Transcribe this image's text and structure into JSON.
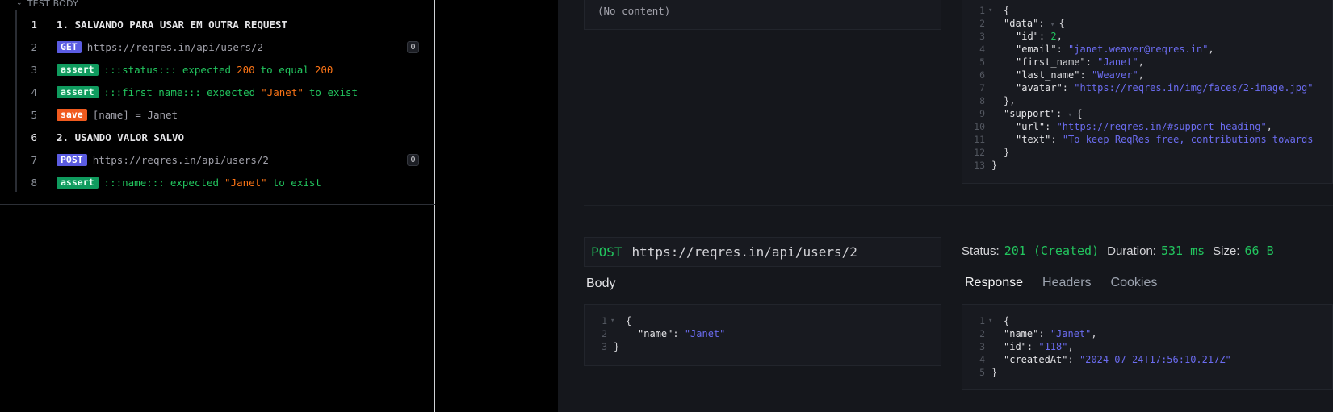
{
  "test_body": {
    "header": "TEST BODY",
    "lines": [
      {
        "num": "1",
        "kind": "section",
        "text": "1. SALVANDO PARA USAR EM OUTRA REQUEST"
      },
      {
        "num": "2",
        "kind": "request",
        "method": "GET",
        "url": "https://reqres.in/api/users/2",
        "count": "0"
      },
      {
        "num": "3",
        "kind": "assert",
        "badge": "assert",
        "subject": ":::status:::",
        "verb": "expected",
        "value": "200",
        "rest": "to equal",
        "value2": "200"
      },
      {
        "num": "4",
        "kind": "assert",
        "badge": "assert",
        "subject": ":::first_name:::",
        "verb": "expected",
        "value": "\"Janet\"",
        "rest": "to exist"
      },
      {
        "num": "5",
        "kind": "save",
        "badge": "save",
        "text": "[name] = Janet"
      },
      {
        "num": "6",
        "kind": "section",
        "text": "2. USANDO VALOR SALVO"
      },
      {
        "num": "7",
        "kind": "request",
        "method": "POST",
        "url": "https://reqres.in/api/users/2",
        "count": "0"
      },
      {
        "num": "8",
        "kind": "assert",
        "badge": "assert",
        "subject": ":::name:::",
        "verb": "expected",
        "value": "\"Janet\"",
        "rest": "to exist"
      }
    ]
  },
  "first_request": {
    "body_text": "(No content)",
    "response_lines": [
      {
        "n": "1",
        "text": "{"
      },
      {
        "n": "2",
        "key": "\"data\"",
        "text": "{"
      },
      {
        "n": "3",
        "key": "\"id\"",
        "num": "2"
      },
      {
        "n": "4",
        "key": "\"email\"",
        "str": "\"janet.weaver@reqres.in\""
      },
      {
        "n": "5",
        "key": "\"first_name\"",
        "str": "\"Janet\""
      },
      {
        "n": "6",
        "key": "\"last_name\"",
        "str": "\"Weaver\""
      },
      {
        "n": "7",
        "key": "\"avatar\"",
        "str": "\"https://reqres.in/img/faces/2-image.jpg\""
      },
      {
        "n": "8",
        "text": "},"
      },
      {
        "n": "9",
        "key": "\"support\"",
        "text": "{"
      },
      {
        "n": "10",
        "key": "\"url\"",
        "str": "\"https://reqres.in/#support-heading\""
      },
      {
        "n": "11",
        "key": "\"text\"",
        "str": "\"To keep ReqRes free, contributions towards"
      },
      {
        "n": "12",
        "text": "}"
      },
      {
        "n": "13",
        "text": "}"
      }
    ]
  },
  "second_request": {
    "method": "POST",
    "url": "https://reqres.in/api/users/2",
    "status_label": "Status:",
    "status_value": "201 (Created)",
    "duration_label": "Duration:",
    "duration_value": "531 ms",
    "size_label": "Size:",
    "size_value": "66 B",
    "body_label": "Body",
    "tabs": [
      "Response",
      "Headers",
      "Cookies"
    ],
    "body_lines": [
      {
        "n": "1",
        "text": "{"
      },
      {
        "n": "2",
        "key": "\"name\"",
        "str": "\"Janet\""
      },
      {
        "n": "3",
        "text": "}"
      }
    ],
    "response_lines": [
      {
        "n": "1",
        "text": "{"
      },
      {
        "n": "2",
        "key": "\"name\"",
        "str": "\"Janet\"",
        "comma": true
      },
      {
        "n": "3",
        "key": "\"id\"",
        "str": "\"118\"",
        "comma": true
      },
      {
        "n": "4",
        "key": "\"createdAt\"",
        "str": "\"2024-07-24T17:56:10.217Z\""
      },
      {
        "n": "5",
        "text": "}"
      }
    ]
  }
}
